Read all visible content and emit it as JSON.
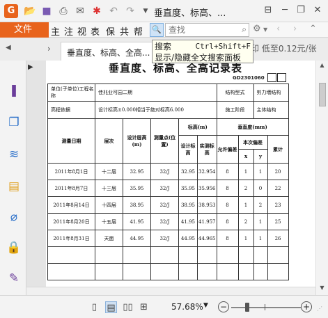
{
  "window": {
    "title": "垂直度、标高、...",
    "controls": [
      "minimize",
      "restore",
      "close"
    ]
  },
  "quick_access": [
    "open-folder-icon",
    "save-icon",
    "print-icon",
    "email-icon",
    "new-icon",
    "undo-icon",
    "redo-icon",
    "customize-dropdown"
  ],
  "menu": {
    "file_label": "文件",
    "items": [
      "主",
      "注",
      "视",
      "表",
      "保",
      "共",
      "帮"
    ],
    "search_placeholder": "查找"
  },
  "tabs": {
    "active_label": "垂直度、标高、全高..."
  },
  "banner": {
    "text": "印 低至0.12元/张"
  },
  "tooltip": {
    "title": "搜索",
    "shortcut": "Ctrl+Shift+F",
    "description": "显示/隐藏全文搜索面板"
  },
  "sidebar": {
    "icons": [
      "bookmark-icon",
      "pages-icon",
      "layers-icon",
      "comments-icon",
      "attachment-icon",
      "security-icon",
      "signature-icon"
    ]
  },
  "document": {
    "heading": "垂直度、标高、全高记录表",
    "code": "GD2301060",
    "project_label": "单位(子单位)工程名称",
    "project_value": "佳兆业可园二期",
    "structure_label": "结构型式",
    "structure_value": "剪力墙结构",
    "basis_label": "高程依据",
    "basis_value": "设计标高±0.000相当于绝对标高6.000",
    "phase_label": "施工阶段",
    "phase_value": "主体结构",
    "headers": {
      "date": "测量日期",
      "floor": "层次",
      "design_height": "设计层高(m)",
      "measure_point": "测量点(位置)",
      "elevation": "标高(m)",
      "design_elev": "设计标高",
      "actual_elev": "实测标高",
      "verticality": "垂直度(mm)",
      "allowed": "允许偏差",
      "layer_dev": "本次偏差",
      "x": "x",
      "y": "y",
      "cumulative": "累计"
    },
    "rows": [
      {
        "date": "2011年8月1日",
        "floor": "十二层",
        "design": "32.95",
        "point": "32/J",
        "elev": "32.95",
        "actual": "32.954",
        "allowed": "8",
        "x": "1",
        "y": "1",
        "cum": "20"
      },
      {
        "date": "2011年8月7日",
        "floor": "十三层",
        "design": "35.95",
        "point": "32/J",
        "elev": "35.95",
        "actual": "35.956",
        "allowed": "8",
        "x": "2",
        "y": "0",
        "cum": "22"
      },
      {
        "date": "2011年8月14日",
        "floor": "十四层",
        "design": "38.95",
        "point": "32/J",
        "elev": "38.95",
        "actual": "38.953",
        "allowed": "8",
        "x": "1",
        "y": "2",
        "cum": "23"
      },
      {
        "date": "2011年8月20日",
        "floor": "十五层",
        "design": "41.95",
        "point": "32/J",
        "elev": "41.95",
        "actual": "41.957",
        "allowed": "8",
        "x": "2",
        "y": "1",
        "cum": "25"
      },
      {
        "date": "2011年8月31日",
        "floor": "天面",
        "design": "44.95",
        "point": "32/J",
        "elev": "44.95",
        "actual": "44.965",
        "allowed": "8",
        "x": "1",
        "y": "1",
        "cum": "26"
      }
    ]
  },
  "status": {
    "zoom": "57.68%",
    "zoom_level_fraction": 0.2
  }
}
